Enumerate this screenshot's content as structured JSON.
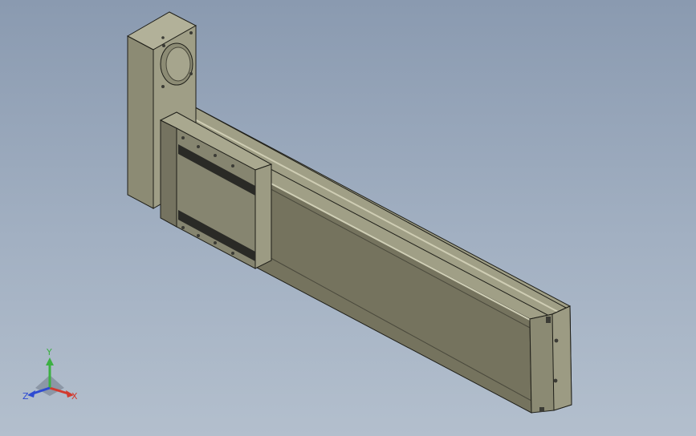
{
  "viewport": {
    "background_top": "#8a9ab0",
    "background_bottom": "#b3bfcd"
  },
  "model": {
    "part": "linear-actuator",
    "face_top": "#a9a88f",
    "face_side": "#75735e",
    "face_front": "#8b8a73",
    "edge": "#1e1e18",
    "rail_slot": "#2a2a26",
    "hole": "#3b3b35"
  },
  "triad": {
    "x_label": "X",
    "y_label": "Y",
    "z_label": "Z",
    "x_color": "#d23a2e",
    "y_color": "#3cb043",
    "z_color": "#2e4bd2"
  }
}
